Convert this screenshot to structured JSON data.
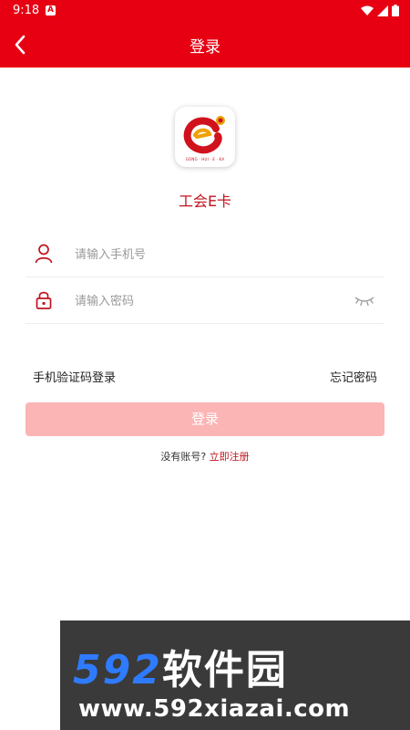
{
  "status_bar": {
    "time": "9:18",
    "notification_icon": "A"
  },
  "header": {
    "title": "登录",
    "back_icon": "chevron-left-icon",
    "background_color": "#e60012"
  },
  "brand": {
    "logo_caption": "GONG · HUI · E · KA",
    "app_name": "工会E卡"
  },
  "form": {
    "phone_placeholder": "请输入手机号",
    "password_placeholder": "请输入密码",
    "sms_login_label": "手机验证码登录",
    "forgot_password_label": "忘记密码",
    "login_button_label": "登录"
  },
  "register": {
    "prompt": "没有账号?",
    "link_label": "立即注册"
  },
  "watermark": {
    "number": "592",
    "name": "软件园",
    "url": "www.592xiazai.com"
  }
}
